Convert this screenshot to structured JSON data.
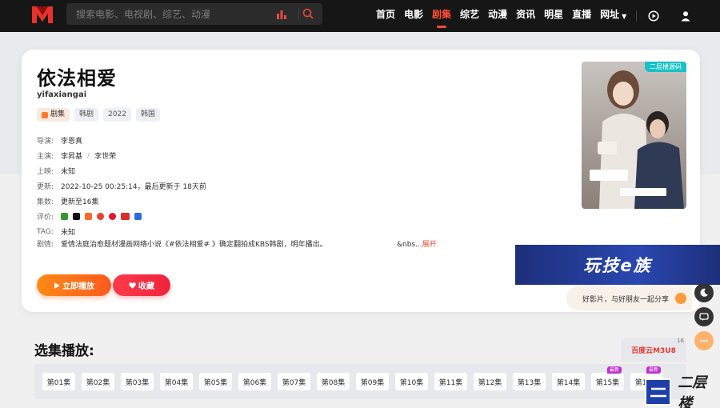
{
  "header": {
    "search_placeholder": "搜索电影、电视剧、综艺、动漫",
    "nav": [
      "首页",
      "电影",
      "剧集",
      "综艺",
      "动漫",
      "资讯",
      "明星",
      "直播",
      "网址"
    ],
    "active_nav": "剧集"
  },
  "detail": {
    "title": "依法相爱",
    "pinyin": "yifaxiangai",
    "tags": [
      "剧集",
      "韩剧",
      "2022",
      "韩国"
    ],
    "director_label": "导演:",
    "director": "李恩真",
    "cast_label": "主演:",
    "cast": [
      "李昇基",
      "李世荣"
    ],
    "release_label": "上映:",
    "release": "未知",
    "update_label": "更新:",
    "update": "2022-10-25 00:25:14，最后更新于 18天前",
    "episodes_label": "集数:",
    "episodes": "更新至16集",
    "rating_label": "评价:",
    "tag_label": "TAG:",
    "tag_value": "未知",
    "synopsis_label": "剧情:",
    "synopsis": "爱情法庭治愈题材漫画网络小说《#依法相爱# 》确定翻拍成KBS韩剧，明年播出。",
    "synopsis_tail": "&nbs...",
    "expand": "展开",
    "play_button": "立即播放",
    "fav_button": "收藏",
    "poster_badge": "二层楼源码"
  },
  "ad": {
    "text": "玩技e族"
  },
  "share": {
    "text": "好影片，与好朋友一起分享"
  },
  "episodes_section": {
    "title": "选集播放:",
    "source": "百度云M3U8",
    "source_count": "16",
    "list": [
      "第01集",
      "第02集",
      "第03集",
      "第04集",
      "第05集",
      "第06集",
      "第07集",
      "第08集",
      "第09集",
      "第10集",
      "第11集",
      "第12集",
      "第13集",
      "第14集",
      "第15集",
      "第16集"
    ],
    "new_badge": "最新"
  },
  "watermark": {
    "text": "二层楼"
  },
  "colors": {
    "accent": "#ff4d36",
    "header_bg": "#161616",
    "play_orange": "#ff7a1a",
    "fav_red": "#f0233b"
  }
}
